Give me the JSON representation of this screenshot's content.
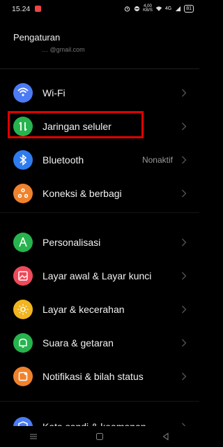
{
  "status_bar": {
    "time": "15.24",
    "net_speed": "4,00\nKB/S",
    "signal": "4G",
    "battery": "81"
  },
  "page": {
    "title": "Pengaturan",
    "account_hint": "… @gmail.com"
  },
  "items": [
    {
      "id": "wifi",
      "label": "Wi-Fi",
      "value": "",
      "icon": "wifi-icon",
      "color": "#4b7bf5"
    },
    {
      "id": "mobile",
      "label": "Jaringan seluler",
      "value": "",
      "icon": "mobile-data-icon",
      "color": "#27b34e"
    },
    {
      "id": "bluetooth",
      "label": "Bluetooth",
      "value": "Nonaktif",
      "icon": "bluetooth-icon",
      "color": "#2f7cf0"
    },
    {
      "id": "sharing",
      "label": "Koneksi & berbagi",
      "value": "",
      "icon": "share-icon",
      "color": "#f0822c"
    },
    {
      "id": "personal",
      "label": "Personalisasi",
      "value": "",
      "icon": "personalization-icon",
      "color": "#27b34e"
    },
    {
      "id": "homescreen",
      "label": "Layar awal & Layar kunci",
      "value": "",
      "icon": "image-icon",
      "color": "#ee4a5a"
    },
    {
      "id": "display",
      "label": "Layar & kecerahan",
      "value": "",
      "icon": "brightness-icon",
      "color": "#f2b51f"
    },
    {
      "id": "sound",
      "label": "Suara & getaran",
      "value": "",
      "icon": "bell-icon",
      "color": "#27b34e"
    },
    {
      "id": "notif",
      "label": "Notifikasi & bilah status",
      "value": "",
      "icon": "notification-icon",
      "color": "#f0822c"
    },
    {
      "id": "password",
      "label": "Kata sandi & keamanan",
      "value": "",
      "icon": "shield-icon",
      "color": "#4b7bf5"
    }
  ],
  "colors": {
    "highlight": "#e00000",
    "background": "#000000"
  },
  "nav": [
    "menu-icon",
    "home-icon",
    "back-icon"
  ]
}
